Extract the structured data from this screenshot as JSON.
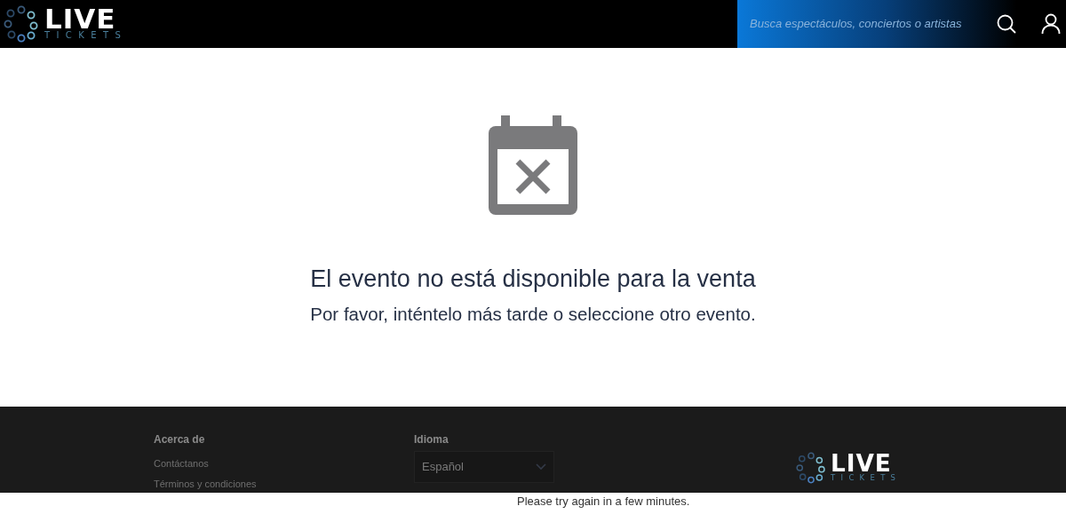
{
  "header": {
    "logo": {
      "word": "LIVE",
      "subword": "TICKETS"
    },
    "search": {
      "placeholder": "Busca espectáculos, conciertos o artistas"
    }
  },
  "message": {
    "title": "El evento no está disponible para la venta",
    "subtitle": "Por favor, inténtelo más tarde o seleccione otro evento."
  },
  "footer": {
    "about": {
      "heading": "Acerca de",
      "links": [
        "Contáctanos",
        "Términos y condiciones"
      ]
    },
    "language": {
      "heading": "Idioma",
      "value": "Español"
    },
    "logo": {
      "word": "LIVE",
      "subword": "TICKETS"
    }
  },
  "behind_text": "Please try again in a few minutes."
}
